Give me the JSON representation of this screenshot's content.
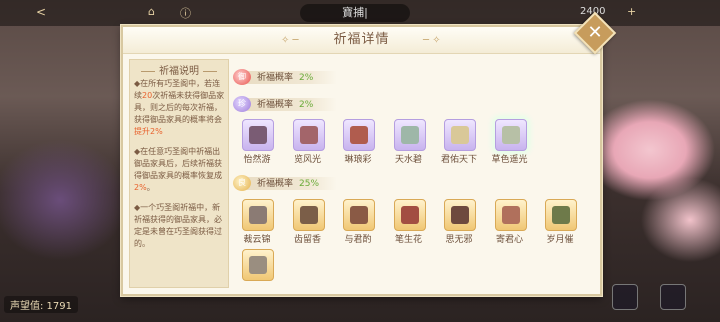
{
  "topbar": {
    "title": "寶捕|",
    "back": "<",
    "score": "2400"
  },
  "bottom_info": "声望值: 1791",
  "dialog": {
    "title": "祈福详情",
    "close": "✕",
    "explain": {
      "title": "祈福说明",
      "p1_a": "◆在所有巧圣阁中，若连续",
      "p1_b": "20",
      "p1_c": "次祈福未获得御品家具，则之后的每次祈福，获得御品家具的概率将会",
      "p1_d": "提升2%",
      "p2_a": "◆在任意巧圣阁中祈福出御品家具后，后续祈福获得御品家具的概率恢复成",
      "p2_b": "2%",
      "p2_c": "。",
      "p3": "◆一个巧圣阁祈福中，新祈福获得的御品家具，必定是未曾在巧圣阁获得过的。"
    },
    "tiers": [
      {
        "badge": "御",
        "label": "祈福概率",
        "pct": "2%"
      },
      {
        "badge": "珍",
        "label": "祈福概率",
        "pct": "2%"
      },
      {
        "badge": "良",
        "label": "祈福概率",
        "pct": "25%"
      }
    ],
    "purple_items": [
      {
        "name": "怡然游",
        "color": "#7a5c74"
      },
      {
        "name": "览风光",
        "color": "#a3656a"
      },
      {
        "name": "琳琅彩",
        "color": "#b05c4e"
      },
      {
        "name": "天水碧",
        "color": "#9eb7a8"
      },
      {
        "name": "君佑天下",
        "color": "#d9c898"
      },
      {
        "name": "草色遥光",
        "color": "#b7c0a6"
      }
    ],
    "gold_items": [
      {
        "name": "裁云锦",
        "color": "#8b7b74"
      },
      {
        "name": "齿留香",
        "color": "#7b5e48"
      },
      {
        "name": "与君酌",
        "color": "#8a5a45"
      },
      {
        "name": "笔生花",
        "color": "#a24e42"
      },
      {
        "name": "思无邪",
        "color": "#6e4a3e"
      },
      {
        "name": "寄君心",
        "color": "#b0705c"
      },
      {
        "name": "岁月催",
        "color": "#6e7a4a"
      },
      {
        "name": "",
        "color": "#9a8e80"
      }
    ]
  }
}
